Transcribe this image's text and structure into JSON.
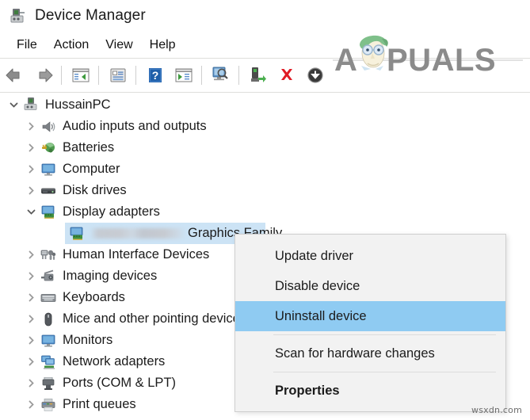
{
  "window": {
    "title": "Device Manager",
    "icon": "device-manager-icon"
  },
  "menubar": {
    "items": [
      {
        "label": "File",
        "name": "menu-file"
      },
      {
        "label": "Action",
        "name": "menu-action"
      },
      {
        "label": "View",
        "name": "menu-view"
      },
      {
        "label": "Help",
        "name": "menu-help"
      }
    ]
  },
  "toolbar": {
    "items": [
      {
        "name": "back-arrow-icon",
        "tip": "Back"
      },
      {
        "name": "forward-arrow-icon",
        "tip": "Forward"
      },
      {
        "name": "separator-1",
        "tip": ""
      },
      {
        "name": "show-hide-console-tree-icon",
        "tip": "Show/Hide console tree"
      },
      {
        "name": "separator-2",
        "tip": ""
      },
      {
        "name": "properties-icon",
        "tip": "Properties"
      },
      {
        "name": "separator-3",
        "tip": ""
      },
      {
        "name": "help-icon",
        "tip": "Help"
      },
      {
        "name": "show-hide-action-pane-icon",
        "tip": "Show/Hide action pane"
      },
      {
        "name": "separator-4",
        "tip": ""
      },
      {
        "name": "scan-for-hardware-changes-icon",
        "tip": "Scan for hardware changes"
      },
      {
        "name": "separator-5",
        "tip": ""
      },
      {
        "name": "update-driver-icon",
        "tip": "Update driver"
      },
      {
        "name": "uninstall-device-icon",
        "tip": "Uninstall device"
      },
      {
        "name": "disable-device-icon",
        "tip": "Disable device"
      }
    ]
  },
  "logo": {
    "text": "APPUALS",
    "name": "appuals-logo"
  },
  "tree": {
    "root": {
      "label": "HussainPC",
      "icon": "computer-root-icon",
      "expanded": true
    },
    "nodes": [
      {
        "label": "Audio inputs and outputs",
        "icon": "speaker-icon",
        "expanded": false,
        "selected": false
      },
      {
        "label": "Batteries",
        "icon": "battery-icon",
        "expanded": false,
        "selected": false
      },
      {
        "label": "Computer",
        "icon": "monitor-icon",
        "expanded": false,
        "selected": false
      },
      {
        "label": "Disk drives",
        "icon": "disk-drive-icon",
        "expanded": false,
        "selected": false
      },
      {
        "label": "Display adapters",
        "icon": "display-adapter-icon",
        "expanded": true,
        "selected": false
      },
      {
        "label": "Graphics Family",
        "icon": "display-adapter-icon",
        "expanded": null,
        "selected": true,
        "child": true,
        "redacted_prefix": true
      },
      {
        "label": "Human Interface Devices",
        "icon": "hid-icon",
        "expanded": false,
        "selected": false
      },
      {
        "label": "Imaging devices",
        "icon": "camera-icon",
        "expanded": false,
        "selected": false
      },
      {
        "label": "Keyboards",
        "icon": "keyboard-icon",
        "expanded": false,
        "selected": false
      },
      {
        "label": "Mice and other pointing devices",
        "icon": "mouse-icon",
        "expanded": false,
        "selected": false
      },
      {
        "label": "Monitors",
        "icon": "monitor-icon",
        "expanded": false,
        "selected": false
      },
      {
        "label": "Network adapters",
        "icon": "network-adapter-icon",
        "expanded": false,
        "selected": false
      },
      {
        "label": "Ports (COM & LPT)",
        "icon": "port-icon",
        "expanded": false,
        "selected": false
      },
      {
        "label": "Print queues",
        "icon": "printer-icon",
        "expanded": false,
        "selected": false
      }
    ]
  },
  "context_menu": {
    "items": [
      {
        "label": "Update driver",
        "name": "ctx-update-driver",
        "highlighted": false,
        "bold": false,
        "separator_after": false
      },
      {
        "label": "Disable device",
        "name": "ctx-disable-device",
        "highlighted": false,
        "bold": false,
        "separator_after": false
      },
      {
        "label": "Uninstall device",
        "name": "ctx-uninstall-device",
        "highlighted": true,
        "bold": false,
        "separator_after": true
      },
      {
        "label": "Scan for hardware changes",
        "name": "ctx-scan-for-hardware-changes",
        "highlighted": false,
        "bold": false,
        "separator_after": true
      },
      {
        "label": "Properties",
        "name": "ctx-properties",
        "highlighted": false,
        "bold": true,
        "separator_after": false
      }
    ]
  },
  "watermark": {
    "text": "wsxdn.com"
  },
  "colors": {
    "selection_row": "#cce3f5",
    "menu_highlight": "#8fcbf2",
    "menu_background": "#f2f2f2",
    "toolbar_border": "#dededc",
    "uninstall_red": "#e01b24",
    "logo_grey": "#8b8b8b",
    "logo_hair_green": "#7fc08a"
  }
}
